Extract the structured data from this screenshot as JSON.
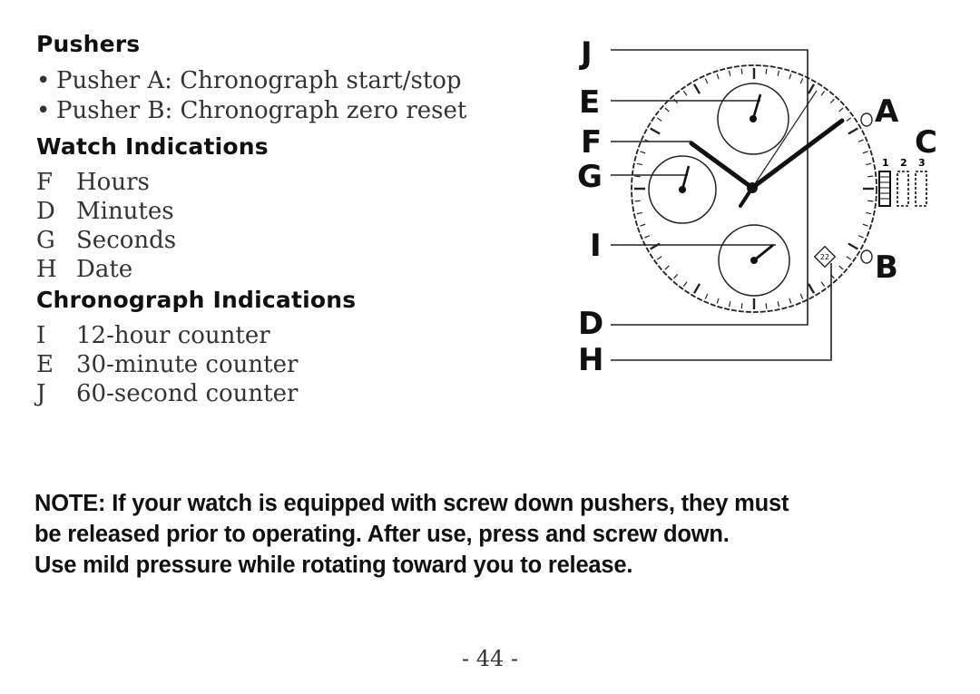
{
  "pushers": {
    "heading": "Pushers",
    "items": [
      {
        "bullet": "•",
        "text": "Pusher A: Chronograph start/stop"
      },
      {
        "bullet": "•",
        "text": "Pusher B: Chronograph zero reset"
      }
    ]
  },
  "watch_indications": {
    "heading": "Watch Indications",
    "items": [
      {
        "code": "F",
        "text": "Hours"
      },
      {
        "code": "D",
        "text": "Minutes"
      },
      {
        "code": "G",
        "text": "Seconds"
      },
      {
        "code": "H",
        "text": "Date"
      }
    ]
  },
  "chronograph_indications": {
    "heading": "Chronograph Indications",
    "items": [
      {
        "code": "I",
        "text": "12-hour counter"
      },
      {
        "code": "E",
        "text": "30-minute counter"
      },
      {
        "code": "J",
        "text": "60-second counter"
      }
    ]
  },
  "diagram": {
    "left_callouts": [
      "J",
      "E",
      "F",
      "G",
      "I",
      "D",
      "H"
    ],
    "right_callouts": {
      "pusher_a": "A",
      "crown": "C",
      "pusher_b": "B"
    },
    "crown_positions": [
      "1",
      "2",
      "3"
    ],
    "date_window": "22"
  },
  "note": {
    "lines": [
      "NOTE: If your watch is equipped with screw down pushers, they must",
      "be released prior to operating. After use, press and screw down.",
      "Use mild pressure while rotating toward you to release."
    ]
  },
  "page_number": "- 44 -"
}
